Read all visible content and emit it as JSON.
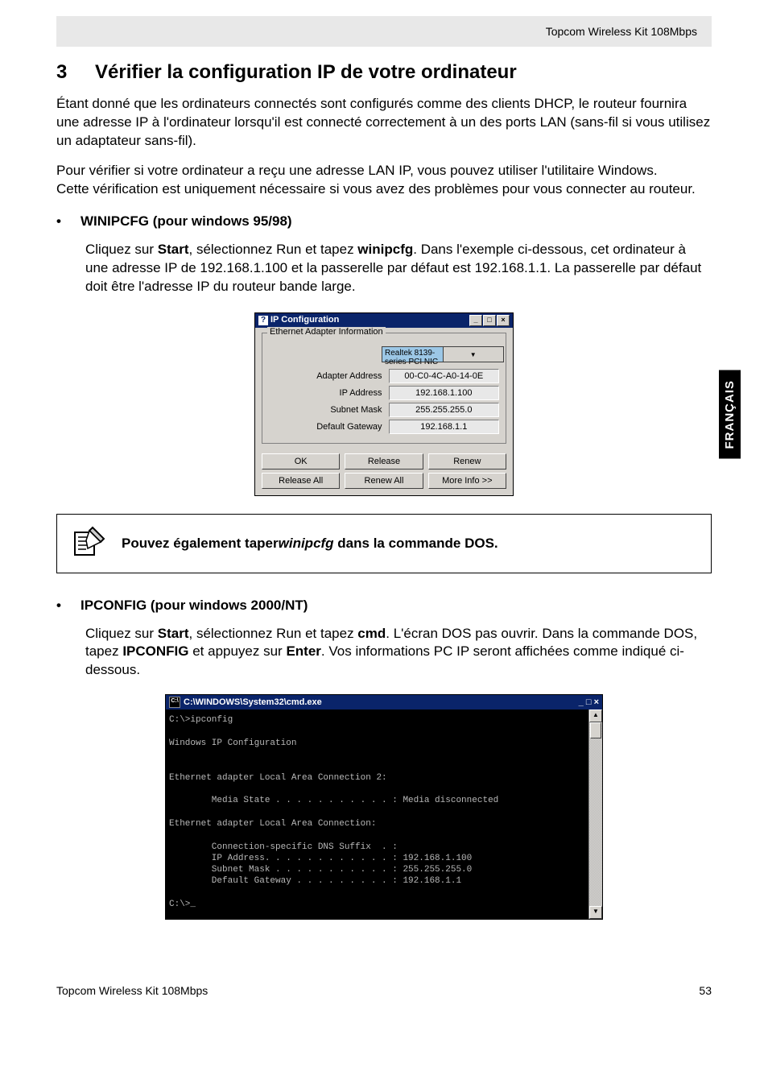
{
  "header": {
    "product": "Topcom Wireless Kit 108Mbps"
  },
  "sideTab": "FRANÇAIS",
  "section": {
    "number": "3",
    "title": "Vérifier la configuration IP de votre ordinateur"
  },
  "intro1": "Étant donné que les ordinateurs connectés sont configurés comme des clients DHCP, le routeur fournira une adresse IP à l'ordinateur lorsqu'il est connecté correctement à un des ports LAN (sans-fil si vous utilisez un adaptateur sans-fil).",
  "intro2": "Pour vérifier si votre ordinateur a reçu une adresse LAN IP, vous pouvez utiliser l'utilitaire Windows.",
  "intro3": "Cette vérification est uniquement nécessaire si vous avez des problèmes pour vous connecter au routeur.",
  "winipcfg": {
    "head": "WINIPCFG (pour windows 95/98)",
    "body_pre": "Cliquez sur ",
    "b1": "Start",
    "body_mid1": ", sélectionnez Run et tapez ",
    "b2": "winipcfg",
    "body_post": ". Dans l'exemple ci-dessous, cet ordinateur à une adresse IP de 192.168.1.100 et la passerelle par défaut est 192.168.1.1. La passerelle par défaut doit être l'adresse IP du routeur bande large."
  },
  "ipcfgDialog": {
    "title": "IP Configuration",
    "group": "Ethernet Adapter Information",
    "combo": "Realtek 8139-series PCI NIC",
    "rows": {
      "adapterAddress": {
        "label": "Adapter Address",
        "value": "00-C0-4C-A0-14-0E"
      },
      "ipAddress": {
        "label": "IP Address",
        "value": "192.168.1.100"
      },
      "subnetMask": {
        "label": "Subnet Mask",
        "value": "255.255.255.0"
      },
      "defaultGateway": {
        "label": "Default Gateway",
        "value": "192.168.1.1"
      }
    },
    "buttons": {
      "ok": "OK",
      "release": "Release",
      "renew": "Renew",
      "releaseAll": "Release All",
      "renewAll": "Renew All",
      "moreInfo": "More Info >>"
    }
  },
  "note": {
    "pre": "Pouvez également taper",
    "cmd": "winipcfg",
    "post": " dans la commande DOS."
  },
  "ipconfig": {
    "head": "IPCONFIG (pour windows 2000/NT)",
    "p_pre": "Cliquez sur ",
    "b1": "Start",
    "p_mid1": ", sélectionnez Run et tapez ",
    "b2": "cmd",
    "p_mid2": ". L'écran DOS pas ouvrir. Dans la commande DOS, tapez ",
    "b3": "IPCONFIG",
    "p_mid3": " et appuyez sur ",
    "b4": "Enter",
    "p_post": ". Vos informations PC IP seront affichées comme indiqué ci-dessous."
  },
  "cmdWindow": {
    "title": "C:\\WINDOWS\\System32\\cmd.exe",
    "body": "C:\\>ipconfig\n\nWindows IP Configuration\n\n\nEthernet adapter Local Area Connection 2:\n\n        Media State . . . . . . . . . . . : Media disconnected\n\nEthernet adapter Local Area Connection:\n\n        Connection-specific DNS Suffix  . :\n        IP Address. . . . . . . . . . . . : 192.168.1.100\n        Subnet Mask . . . . . . . . . . . : 255.255.255.0\n        Default Gateway . . . . . . . . . : 192.168.1.1\n\nC:\\>_"
  },
  "footer": {
    "left": "Topcom Wireless Kit 108Mbps",
    "right": "53"
  }
}
